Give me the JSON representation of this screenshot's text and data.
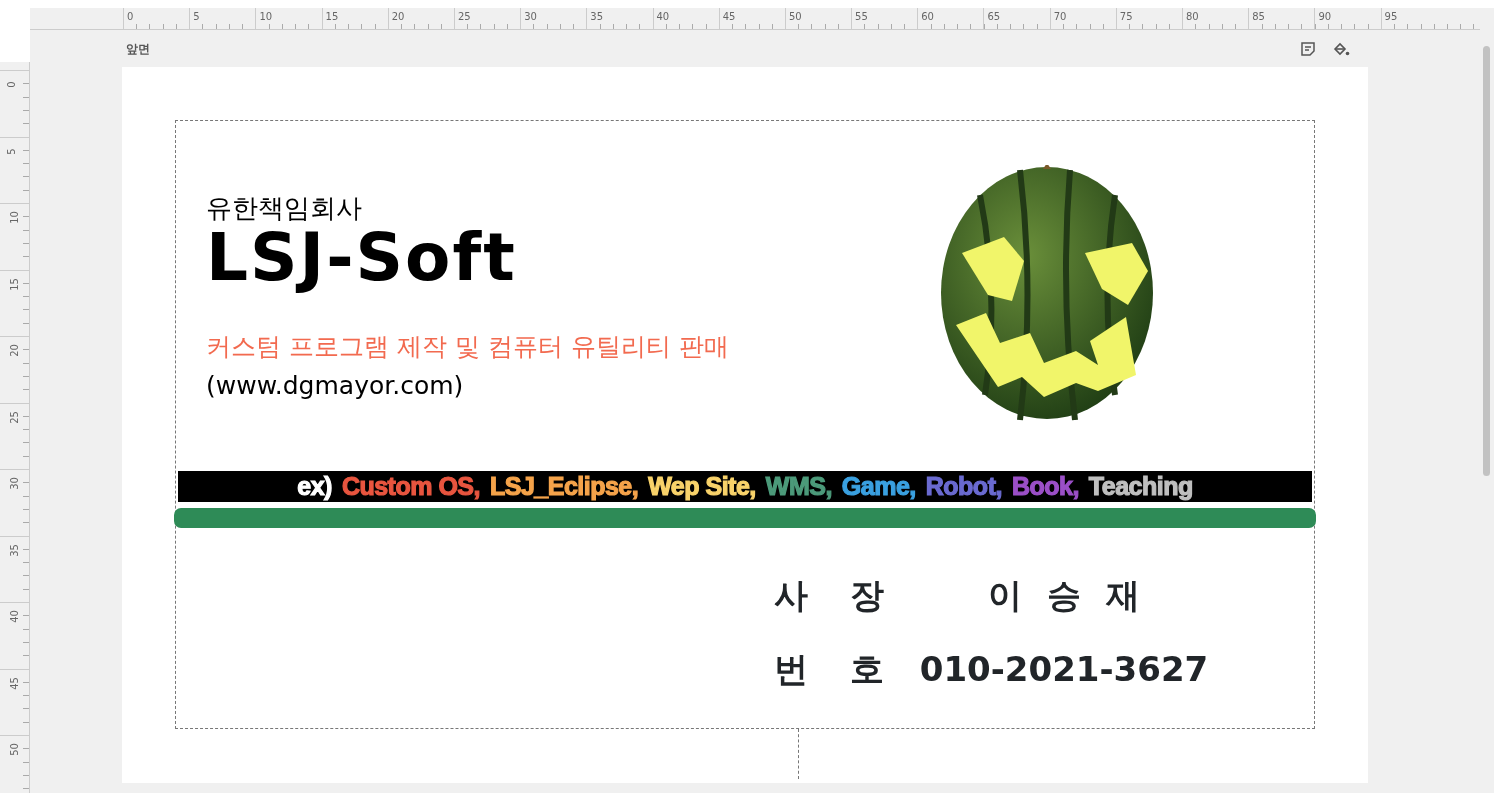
{
  "rulers": {
    "horizontal": [
      "0",
      "5",
      "10",
      "15",
      "20",
      "25",
      "30",
      "35",
      "40",
      "45",
      "50",
      "55",
      "60",
      "65",
      "70",
      "75",
      "80",
      "85",
      "90",
      "95"
    ],
    "vertical": [
      "0",
      "5",
      "10",
      "15",
      "20",
      "25",
      "30",
      "35",
      "40",
      "45",
      "50"
    ]
  },
  "page": {
    "side_label": "앞면"
  },
  "card": {
    "company_type": "유한책임회사",
    "logo": "LSJ-Soft",
    "tagline": "커스텀 프로그램 제작 및 컴퓨터 유틸리티 판매",
    "website": "(www.dgmayor.com)",
    "services": [
      {
        "text": "ex)",
        "color": "#ffffff"
      },
      {
        "text": "Custom OS,",
        "color": "#e8553f"
      },
      {
        "text": "LSJ_Eclipse,",
        "color": "#f5a34a"
      },
      {
        "text": "Wep Site,",
        "color": "#f8d26a"
      },
      {
        "text": "WMS,",
        "color": "#4c9a7a"
      },
      {
        "text": "Game,",
        "color": "#3aa0e0"
      },
      {
        "text": "Robot,",
        "color": "#6a6ad0"
      },
      {
        "text": "Book,",
        "color": "#9b4fc7"
      },
      {
        "text": "Teaching",
        "color": "#bfbfbf"
      }
    ],
    "contacts": [
      {
        "label": "사 장",
        "value": "이 승 재"
      },
      {
        "label": "번 호",
        "value": "010-2021-3627"
      }
    ]
  }
}
